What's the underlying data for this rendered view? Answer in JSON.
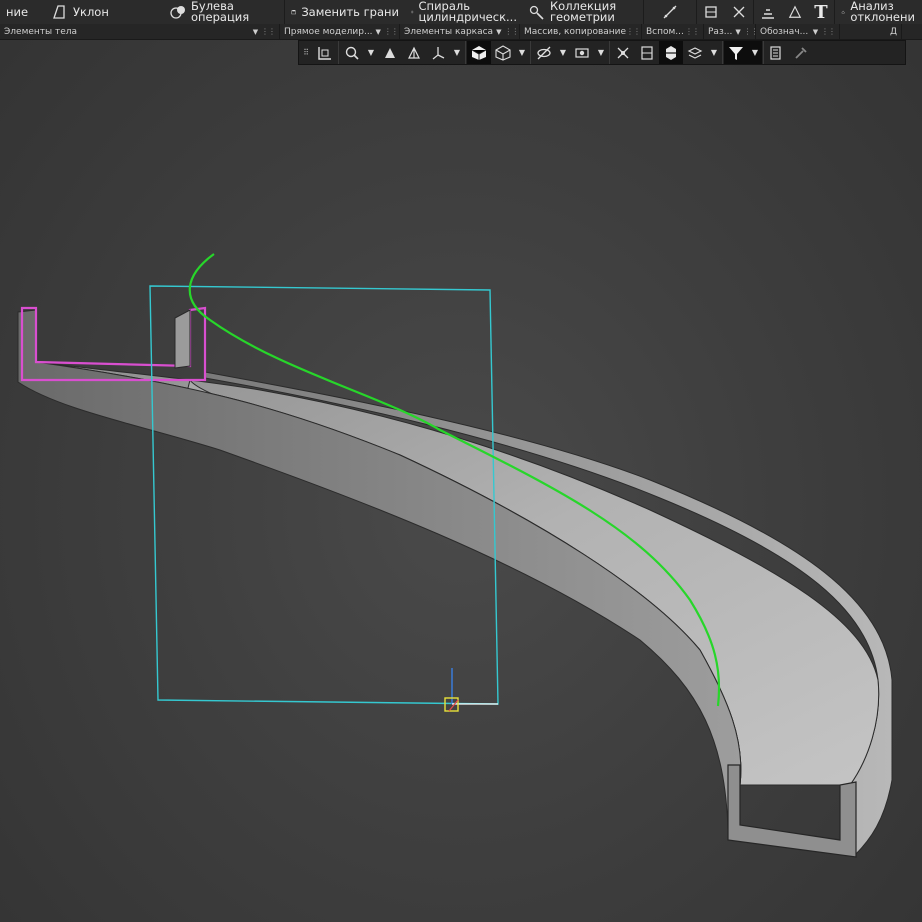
{
  "ribbon": {
    "items": [
      {
        "label": "ние",
        "icon": null
      },
      {
        "label": "Уклон",
        "icon": "draft-icon"
      },
      {
        "label": "Булева\nоперация",
        "icon": "boolean-icon"
      },
      {
        "label": "Заменить грани",
        "icon": "replace-face-icon"
      },
      {
        "label": "Спираль\nцилиндрическ...",
        "icon": "spiral-icon"
      },
      {
        "label": "Коллекция\nгеометрии",
        "icon": "geometry-collection-icon"
      },
      {
        "label": "",
        "icon": "line-icon"
      },
      {
        "label": "",
        "icon": "dimension-icon"
      },
      {
        "label": "",
        "icon": "measure-icon"
      },
      {
        "label": "",
        "icon": "layers-icon"
      },
      {
        "label": "",
        "icon": "drawing-icon"
      },
      {
        "label": "T",
        "icon": "text-icon"
      },
      {
        "label": "Анализ\nотклонени",
        "icon": "deviation-analysis-icon"
      }
    ]
  },
  "groups": [
    {
      "label": "Элементы тела",
      "caret": true
    },
    {
      "label": "Прямое моделир...",
      "caret": true
    },
    {
      "label": "Элементы каркаса",
      "caret": true
    },
    {
      "label": "Массив, копирование",
      "caret": false
    },
    {
      "label": "Вспом...",
      "caret": true
    },
    {
      "label": "Раз...",
      "caret": true
    },
    {
      "label": "Обознач...",
      "caret": true
    },
    {
      "label": "Д",
      "caret": false
    }
  ],
  "view_toolbar": [
    {
      "name": "orientation-icon",
      "type": "btn"
    },
    {
      "name": "zoom-icon",
      "type": "btn"
    },
    {
      "name": "zoom-dropdown",
      "type": "dd"
    },
    {
      "name": "shaded-view-icon",
      "type": "btn"
    },
    {
      "name": "wireframe-icon",
      "type": "btn"
    },
    {
      "name": "shading-dropdown",
      "type": "dd"
    },
    {
      "name": "cube-solid-icon",
      "type": "btn",
      "active": true
    },
    {
      "name": "cube-wire-icon",
      "type": "btn"
    },
    {
      "name": "display-dropdown",
      "type": "dd"
    },
    {
      "name": "hide-icon",
      "type": "btn"
    },
    {
      "name": "hide-dropdown",
      "type": "dd"
    },
    {
      "name": "eye-icon",
      "type": "btn"
    },
    {
      "name": "eye-dropdown",
      "type": "dd"
    },
    {
      "name": "constraints-icon",
      "type": "btn"
    },
    {
      "name": "section-icon",
      "type": "btn"
    },
    {
      "name": "layers-view-icon",
      "type": "btn"
    },
    {
      "name": "layers-dropdown",
      "type": "dd"
    },
    {
      "name": "filter-icon",
      "type": "btn",
      "active": true
    },
    {
      "name": "filter-dropdown",
      "type": "dd"
    },
    {
      "name": "properties-icon",
      "type": "btn"
    },
    {
      "name": "eyedropper-icon",
      "type": "btn"
    }
  ],
  "colors": {
    "sketch_plane": "#35c8d0",
    "path_curve": "#27d62a",
    "profile_highlight": "#d94fd0",
    "model_light": "#9a9a9a",
    "model_shadow": "#6e6e6e"
  }
}
